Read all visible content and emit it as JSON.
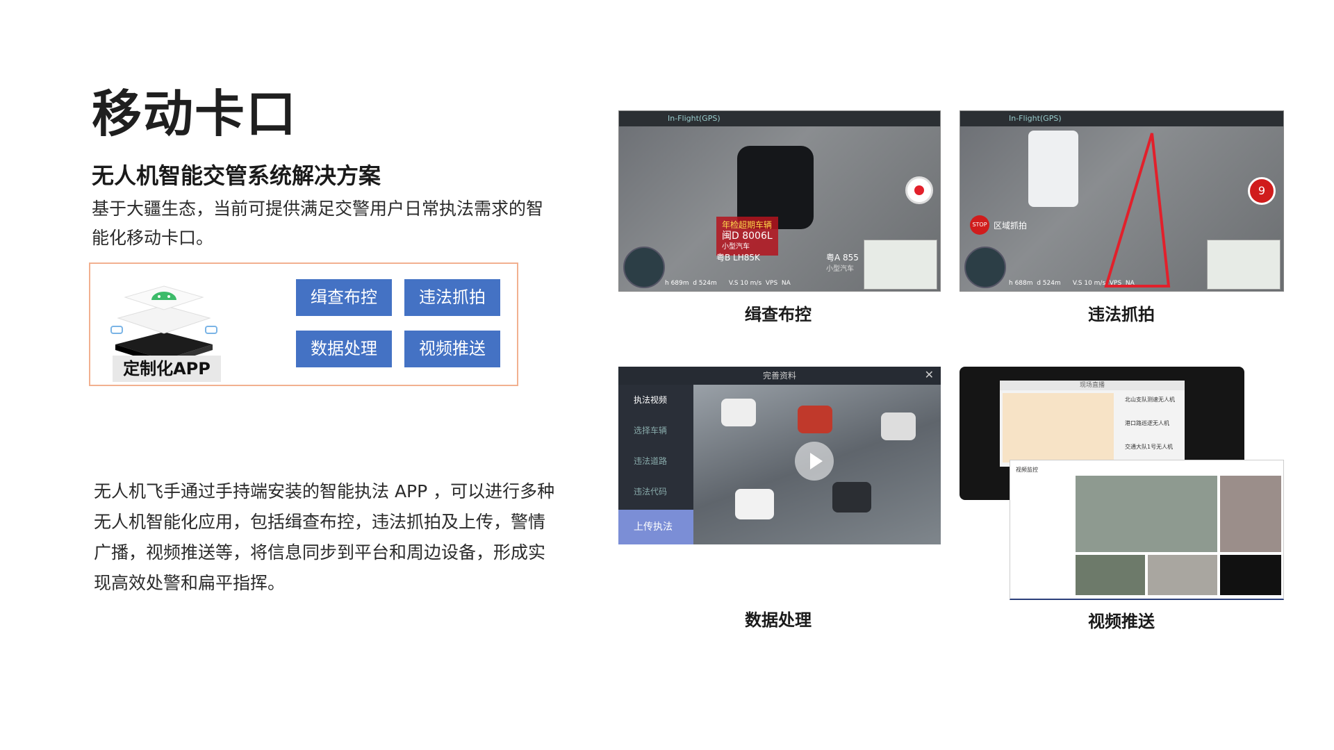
{
  "title": "移动卡口",
  "subtitle": "无人机智能交管系统解决方案",
  "intro": "基于大疆生态，当前可提供满足交警用户日常执法需求的智能化移动卡口。",
  "app": {
    "label": "定制化APP",
    "features": [
      "缉查布控",
      "违法抓拍",
      "数据处理",
      "视频推送"
    ]
  },
  "description": "无人机飞手通过手持端安装的智能执法 APP ，可以进行多种无人机智能化应用，包括缉查布控，违法抓拍及上传，警情广播，视频推送等，将信息同步到平台和周边设备，形成实现高效处警和扁平指挥。",
  "panels": [
    {
      "caption": "缉查布控",
      "hud": "In-Flight(GPS)",
      "alert_title": "年检超期车辆",
      "alert_plate": "闽D 8006L",
      "alert_type": "小型汽车",
      "plate_2": "粤B LH85K",
      "plate_3": "粤A 855",
      "type_small": "小型汽车",
      "telemetry": "h 689m  d 524m      V.S 10 m/s  VPS  NA"
    },
    {
      "caption": "违法抓拍",
      "hud": "In-Flight(GPS)",
      "zone_label": "区域抓拍",
      "stop": "STOP",
      "counter": "9",
      "telemetry": "h 688m  d 524m      V.S 10 m/s  VPS  NA"
    },
    {
      "caption": "数据处理",
      "header": "完善资料",
      "menu": [
        "执法视频",
        "选择车辆",
        "违法道路",
        "违法代码"
      ],
      "active": "上传执法"
    },
    {
      "caption": "视频推送",
      "map_title": "现场直播",
      "list": [
        "北山支队测速无人机",
        "港口路巡逻无人机",
        "交通大队1号无人机"
      ],
      "monitor_title": "视频监控"
    }
  ],
  "colors": {
    "button_bg": "#4472c4",
    "app_box_border": "#f2b08f",
    "alert_red": "#e2202b"
  }
}
